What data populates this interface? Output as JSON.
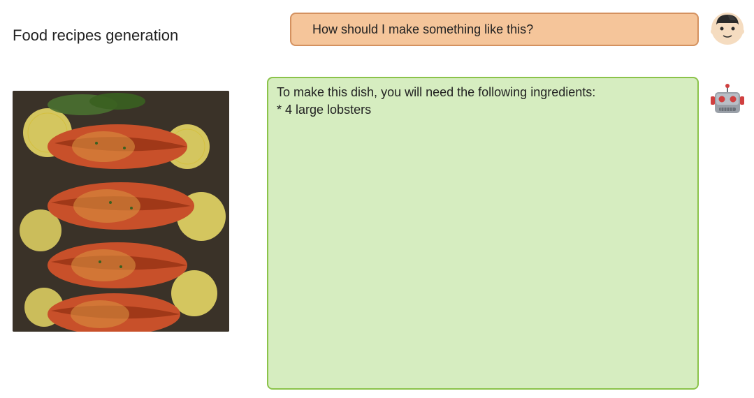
{
  "title": "Food recipes generation",
  "user_message": "How should I make something like this?",
  "bot_message": "To make this dish, you will need the following ingredients:\n* 4 large lobsters",
  "image_description": "grilled lobster tails with lemon slices and herbs"
}
